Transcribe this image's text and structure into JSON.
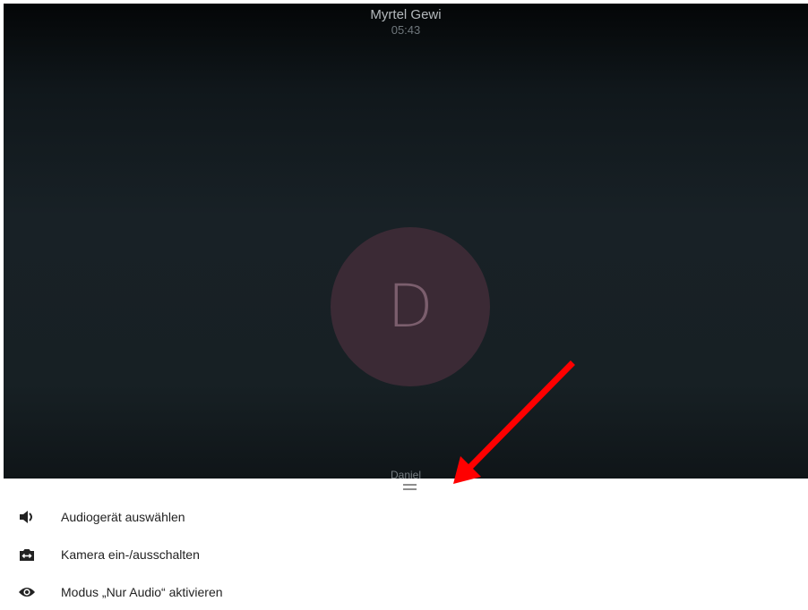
{
  "call": {
    "caller_name": "Myrtel Gewi",
    "timer": "05:43",
    "avatar_initial": "D",
    "self_name": "Daniel"
  },
  "menu": {
    "items": [
      {
        "label": "Audiogerät auswählen",
        "icon": "speaker-icon"
      },
      {
        "label": "Kamera ein-/ausschalten",
        "icon": "camera-switch-icon"
      },
      {
        "label": "Modus „Nur Audio“ aktivieren",
        "icon": "eye-icon"
      }
    ]
  },
  "annotation": {
    "arrow_color": "#ff0000"
  },
  "colors": {
    "avatar_bg": "#3b2a35",
    "background_top": "#040607",
    "background_mid": "#182126"
  }
}
